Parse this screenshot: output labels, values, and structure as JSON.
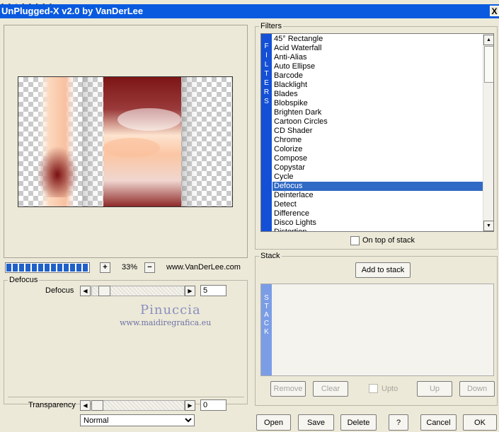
{
  "window": {
    "title": "UnPlugged-X v2.0 by VanDerLee",
    "close_glyph": "X"
  },
  "zoom": {
    "plus": "+",
    "minus": "−",
    "value": "33%",
    "site": "www.VanDerLee.com"
  },
  "effect_group": {
    "title": "Defocus",
    "param_label": "Defocus",
    "param_value": "5"
  },
  "watermark": {
    "line1": "Pinuccia",
    "line2": "www.maidiregrafica.eu"
  },
  "transparency": {
    "label": "Transparency",
    "value": "0"
  },
  "blend_mode": {
    "selected": "Normal"
  },
  "filters": {
    "group_title": "Filters",
    "side_letters": [
      "F",
      "I",
      "L",
      "T",
      "E",
      "R",
      "S"
    ],
    "items": [
      "45° Rectangle",
      "Acid Waterfall",
      "Anti-Alias",
      "Auto Ellipse",
      "Barcode",
      "Blacklight",
      "Blades",
      "Blobspike",
      "Brighten Dark",
      "Cartoon Circles",
      "CD Shader",
      "Chrome",
      "Colorize",
      "Compose",
      "Copystar",
      "Cycle",
      "Defocus",
      "Deinterlace",
      "Detect",
      "Difference",
      "Disco Lights",
      "Distortion"
    ],
    "selected": "Defocus",
    "on_top_label": "On top of stack"
  },
  "stack": {
    "group_title": "Stack",
    "add_label": "Add to stack",
    "side_letters": [
      "S",
      "T",
      "A",
      "C",
      "K"
    ],
    "remove_label": "Remove",
    "clear_label": "Clear",
    "upto_label": "Upto",
    "up_label": "Up",
    "down_label": "Down"
  },
  "footer": {
    "open": "Open",
    "save": "Save",
    "delete": "Delete",
    "help": "?",
    "cancel": "Cancel",
    "ok": "OK"
  },
  "colors": {
    "titlebar": "#0a5ae0",
    "selection": "#316ac5",
    "filters_strip": "#1450d6",
    "stack_strip": "#7b9de6"
  }
}
